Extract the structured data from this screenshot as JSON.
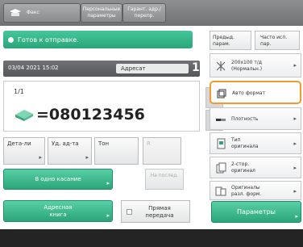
{
  "topbar": {
    "fax_tab": "Факс",
    "personal_tab": "Персональные параметры",
    "shared_tab": "Гарант. адр./перепр."
  },
  "status": {
    "text": "Готов к отправке."
  },
  "info": {
    "datetime": "03/04 2021 15:02",
    "addressee_label": "Адресат",
    "addressee_count": "1"
  },
  "destination": {
    "counter": "1/1",
    "number": "=080123456"
  },
  "row_buttons": {
    "details": "Дета-ли",
    "delete": "Уд. ад-та",
    "tone": "Тон",
    "r": "R"
  },
  "buttons": {
    "one_click": "В одно касание",
    "to": "На послед.",
    "address_book": "Адресная книга",
    "direct_send": "Прямая передача",
    "options": "Параметры"
  },
  "right_panel": {
    "prev_settings": "Предыд. парам.",
    "frequent": "Часто исп. пар.",
    "resolution": "200x100 т/д (Нормальн.)",
    "auto_format": "Авто формат",
    "density": "Плотность",
    "original_type": "Тип оригинала",
    "duplex": "2-стор. оригинал",
    "mixed_size": "Оригиналы разл. форм."
  },
  "colors": {
    "accent_green": "#2ca57b",
    "highlight_orange": "#f39a2c"
  }
}
